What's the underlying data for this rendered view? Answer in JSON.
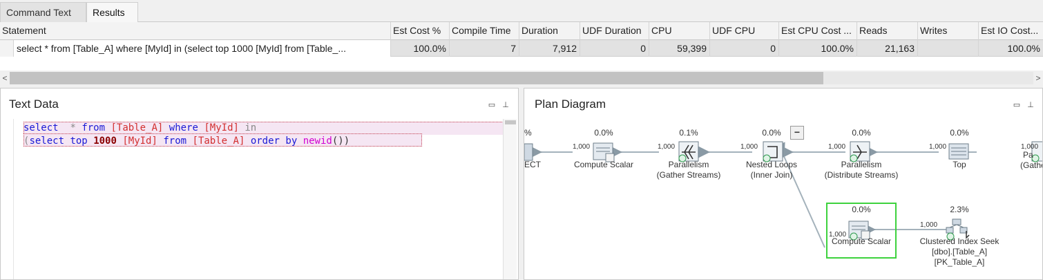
{
  "tabs": [
    {
      "label": "Command Text",
      "active": false
    },
    {
      "label": "Results",
      "active": true
    }
  ],
  "grid": {
    "columns": [
      "Statement",
      "Est Cost %",
      "Compile Time",
      "Duration",
      "UDF Duration",
      "CPU",
      "UDF CPU",
      "Est CPU Cost ...",
      "Reads",
      "Writes",
      "Est IO Cost..."
    ],
    "row": {
      "statement": "select * from [Table_A] where [MyId] in (select top 1000 [MyId] from [Table_...",
      "est_cost": "100.0%",
      "compile_time": "7",
      "duration": "7,912",
      "udf_duration": "0",
      "cpu": "59,399",
      "udf_cpu": "0",
      "est_cpu_cost": "100.0%",
      "reads": "21,163",
      "writes": "",
      "est_io_cost": "100.0%"
    }
  },
  "scroll": {
    "left": "<",
    "right": ">"
  },
  "text_panel": {
    "title": "Text Data",
    "lines": [
      [
        {
          "t": "select",
          "c": "kw"
        },
        {
          "t": "  ",
          "c": "plain"
        },
        {
          "t": "*",
          "c": "op"
        },
        {
          "t": " ",
          "c": "plain"
        },
        {
          "t": "from",
          "c": "kw"
        },
        {
          "t": " ",
          "c": "plain"
        },
        {
          "t": "[Table_A]",
          "c": "id"
        },
        {
          "t": " ",
          "c": "plain"
        },
        {
          "t": "where",
          "c": "kw"
        },
        {
          "t": " ",
          "c": "plain"
        },
        {
          "t": "[MyId]",
          "c": "id"
        },
        {
          "t": " ",
          "c": "plain"
        },
        {
          "t": "in",
          "c": "op"
        }
      ],
      [
        {
          "t": "(",
          "c": "op"
        },
        {
          "t": "select",
          "c": "kw"
        },
        {
          "t": " ",
          "c": "plain"
        },
        {
          "t": "top",
          "c": "kw"
        },
        {
          "t": " ",
          "c": "plain"
        },
        {
          "t": "1000",
          "c": "num-lit"
        },
        {
          "t": " ",
          "c": "plain"
        },
        {
          "t": "[MyId]",
          "c": "id"
        },
        {
          "t": " ",
          "c": "plain"
        },
        {
          "t": "from",
          "c": "kw"
        },
        {
          "t": " ",
          "c": "plain"
        },
        {
          "t": "[Table_A]",
          "c": "id"
        },
        {
          "t": " ",
          "c": "plain"
        },
        {
          "t": "order",
          "c": "kw"
        },
        {
          "t": " ",
          "c": "plain"
        },
        {
          "t": "by",
          "c": "kw"
        },
        {
          "t": " ",
          "c": "plain"
        },
        {
          "t": "newid",
          "c": "fn"
        },
        {
          "t": "())",
          "c": "plain"
        }
      ]
    ]
  },
  "plan_panel": {
    "title": "Plan Diagram",
    "collapse_label": "−",
    "nodes": [
      {
        "id": "select",
        "pct": "%",
        "lines": [
          "ECT"
        ]
      },
      {
        "id": "compute1",
        "pct": "0.0%",
        "lines": [
          "Compute Scalar"
        ]
      },
      {
        "id": "par1",
        "pct": "0.1%",
        "lines": [
          "Parallelism",
          "(Gather Streams)"
        ]
      },
      {
        "id": "nested",
        "pct": "0.0%",
        "lines": [
          "Nested Loops",
          "(Inner Join)"
        ]
      },
      {
        "id": "par2",
        "pct": "0.0%",
        "lines": [
          "Parallelism",
          "(Distribute Streams)"
        ]
      },
      {
        "id": "top",
        "pct": "0.0%",
        "lines": [
          "Top"
        ]
      },
      {
        "id": "par3",
        "pct": "",
        "lines": [
          "Pa",
          "(Gathe"
        ]
      },
      {
        "id": "compute2",
        "pct": "0.0%",
        "lines": [
          "Compute Scalar"
        ]
      },
      {
        "id": "seek",
        "pct": "2.3%",
        "lines": [
          "Clustered Index Seek",
          "[dbo].[Table_A]",
          "[PK_Table_A]"
        ]
      }
    ],
    "edge_labels": [
      "1,000",
      "1,000",
      "1,000",
      "1,000",
      "1,000",
      "1,000",
      "1,000"
    ]
  },
  "panel_buttons": {
    "restore": "▭",
    "pin": "⊥"
  }
}
